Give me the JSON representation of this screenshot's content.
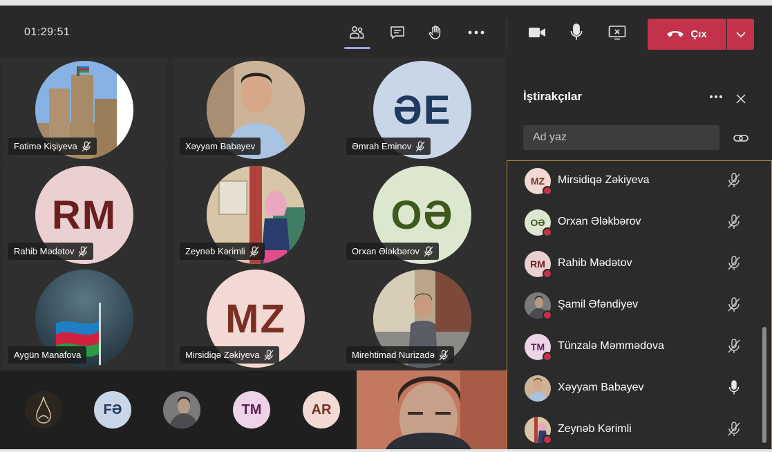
{
  "toolbar": {
    "timer": "01:29:51",
    "leave_label": "Çıx",
    "icons": [
      "people-icon",
      "chat-icon",
      "raise-hand-icon",
      "more-icon",
      "camera-icon",
      "mic-icon",
      "share-screen-icon",
      "phone-hangup-icon",
      "chevron-down-icon"
    ]
  },
  "grid": {
    "tiles": [
      {
        "name": "Fatimə Kişiyeva",
        "type": "photo",
        "photo": "castle"
      },
      {
        "name": "Xəyyam Babayev",
        "type": "photo",
        "photo": "man-blue-shirt"
      },
      {
        "name": "Əmrah Eminov",
        "type": "initials",
        "initials": "ƏE",
        "bg": "#c9d6e8",
        "fg": "#1f3a5f"
      },
      {
        "name": "Rahib Mədətov",
        "type": "initials",
        "initials": "RM",
        "bg": "#ead0d0",
        "fg": "#6b1e1e"
      },
      {
        "name": "Zeynəb Kərimli",
        "type": "photo",
        "photo": "woman-hijab"
      },
      {
        "name": "Orxan Ələkbərov",
        "type": "initials",
        "initials": "OƏ",
        "bg": "#dde6cf",
        "fg": "#3c5a1c"
      },
      {
        "name": "Aygün Manafova",
        "type": "photo",
        "photo": "flag"
      },
      {
        "name": "Mirsidiqə Zəkiyeva",
        "type": "initials",
        "initials": "MZ",
        "bg": "#f3d9d3",
        "fg": "#7a2f22"
      },
      {
        "name": "Mirehtimad Nurizadə",
        "type": "photo",
        "photo": "man-street"
      }
    ]
  },
  "strip": {
    "avatars": [
      {
        "type": "photo",
        "photo": "calligraphy"
      },
      {
        "type": "initials",
        "initials": "FƏ",
        "bg": "#c9d6e8",
        "fg": "#1f3a5f"
      },
      {
        "type": "photo",
        "photo": "man-gray"
      },
      {
        "type": "initials",
        "initials": "TM",
        "bg": "#ecd3e8",
        "fg": "#5a1f52"
      },
      {
        "type": "initials",
        "initials": "AR",
        "bg": "#f3d9d3",
        "fg": "#7a2f22"
      }
    ]
  },
  "panel": {
    "title": "İştirakçılar",
    "search_placeholder": "Ad yaz",
    "participants": [
      {
        "name": "Mirsidiqə Zəkiyeva",
        "initials": "MZ",
        "bg": "#f3d9d3",
        "fg": "#7a2f22",
        "muted": true
      },
      {
        "name": "Orxan Ələkbərov",
        "initials": "OƏ",
        "bg": "#dde6cf",
        "fg": "#3c5a1c",
        "muted": true
      },
      {
        "name": "Rahib Mədətov",
        "initials": "RM",
        "bg": "#ead0d0",
        "fg": "#6b1e1e",
        "muted": true
      },
      {
        "name": "Şamil Əfəndiyev",
        "initials": "",
        "photo": "man-gray",
        "muted": true
      },
      {
        "name": "Tünzalə Məmmədova",
        "initials": "TM",
        "bg": "#ecd3e8",
        "fg": "#5a1f52",
        "muted": true
      },
      {
        "name": "Xəyyam Babayev",
        "initials": "",
        "photo": "man-blue-shirt",
        "muted": false
      },
      {
        "name": "Zeynəb Kərimli",
        "initials": "",
        "photo": "woman-hijab",
        "muted": true
      }
    ]
  },
  "colors": {
    "accent": "#9ea2ff",
    "leave": "#c4314b",
    "panel_border": "#b48a3c"
  }
}
